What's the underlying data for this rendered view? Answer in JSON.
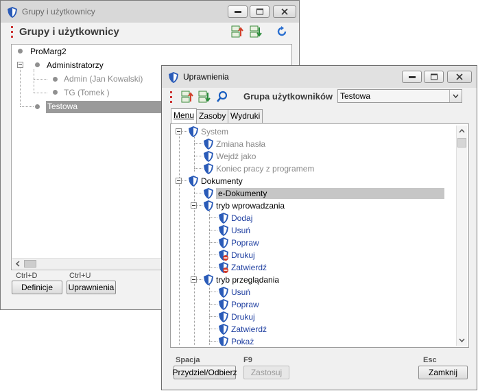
{
  "win1": {
    "title": "Grupy i użytkownicy",
    "header_title": "Grupy i użytkownicy",
    "icons": [
      "import-icon",
      "export-icon",
      "refresh-icon"
    ],
    "tree": [
      {
        "label": "ProMarg2",
        "level": 0
      },
      {
        "label": "Administratorzy",
        "level": 1
      },
      {
        "label": "Admin (Jan Kowalski)",
        "level": 2
      },
      {
        "label": "TG (Tomek )",
        "level": 2
      },
      {
        "label": "Testowa",
        "level": 1,
        "selected": true
      }
    ],
    "hotkeys": {
      "definicje": "Ctrl+D",
      "uprawnienia": "Ctrl+U"
    },
    "buttons": {
      "definicje": "Definicje",
      "uprawnienia": "Uprawnienia"
    }
  },
  "win2": {
    "title": "Uprawnienia",
    "group_label": "Grupa użytkowników",
    "group_value": "Testowa",
    "tabs": [
      {
        "label": "Menu",
        "active": true
      },
      {
        "label": "Zasoby"
      },
      {
        "label": "Wydruki"
      }
    ],
    "tree": [
      {
        "label": "System",
        "level": 0,
        "color": "gray",
        "expander": true
      },
      {
        "label": "Zmiana hasła",
        "level": 1,
        "color": "gray"
      },
      {
        "label": "Wejdź jako",
        "level": 1,
        "color": "gray"
      },
      {
        "label": "Koniec pracy z programem",
        "level": 1,
        "color": "gray"
      },
      {
        "label": "Dokumenty",
        "level": 0,
        "color": "black",
        "expander": true
      },
      {
        "label": "e-Dokumenty",
        "level": 1,
        "color": "black",
        "selected": true
      },
      {
        "label": "tryb wprowadzania",
        "level": 1,
        "color": "black",
        "expander": true
      },
      {
        "label": "Dodaj",
        "level": 2,
        "color": "blue"
      },
      {
        "label": "Usuń",
        "level": 2,
        "color": "blue"
      },
      {
        "label": "Popraw",
        "level": 2,
        "color": "blue"
      },
      {
        "label": "Drukuj",
        "level": 2,
        "color": "blue",
        "denied": true
      },
      {
        "label": "Zatwierdź",
        "level": 2,
        "color": "blue",
        "denied": true
      },
      {
        "label": "tryb przeglądania",
        "level": 1,
        "color": "black",
        "expander": true
      },
      {
        "label": "Usuń",
        "level": 2,
        "color": "blue"
      },
      {
        "label": "Popraw",
        "level": 2,
        "color": "blue"
      },
      {
        "label": "Drukuj",
        "level": 2,
        "color": "blue"
      },
      {
        "label": "Zatwierdź",
        "level": 2,
        "color": "blue"
      },
      {
        "label": "Pokaż",
        "level": 2,
        "color": "blue"
      }
    ],
    "hotkeys": {
      "assign": "Spacja",
      "apply": "F9",
      "close": "Esc"
    },
    "buttons": {
      "assign": "Przydziel/Odbierz",
      "apply": "Zastosuj",
      "close": "Zamknij"
    }
  },
  "colors": {
    "shield_blue": "#2a5bb8",
    "deny_red": "#d23a2a",
    "selection": "#c6c6c6",
    "red_dots": "#cc3333"
  }
}
